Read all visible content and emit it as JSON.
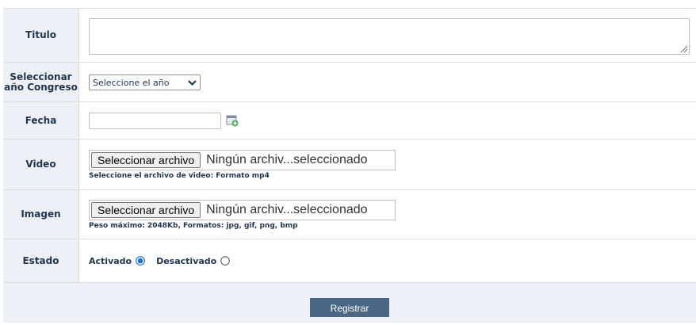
{
  "form": {
    "titulo": {
      "label": "Titulo",
      "value": ""
    },
    "congreso": {
      "label": "Seleccionar año Congreso",
      "selected": "Seleccione el año"
    },
    "fecha": {
      "label": "Fecha",
      "value": ""
    },
    "video": {
      "label": "Video",
      "button": "Seleccionar archivo",
      "status": "Ningún archiv...seleccionado",
      "hint": "Seleccione el archivo de video: Formato mp4"
    },
    "imagen": {
      "label": "Imagen",
      "button": "Seleccionar archivo",
      "status": "Ningún archiv...seleccionado",
      "hint": "Peso máximo: 2048Kb, Formatos: jpg, gif, png, bmp"
    },
    "estado": {
      "label": "Estado",
      "options": [
        {
          "label": "Activado",
          "checked": true
        },
        {
          "label": "Desactivado",
          "checked": false
        }
      ]
    },
    "submit": "Registrar"
  },
  "icons": {
    "calendar": "calendar-add-icon",
    "dropdown": "chevron-down-icon"
  },
  "colors": {
    "label_bg": "#edf1f7",
    "label_text": "#1f3550",
    "radio_selected": "#1a73e8",
    "submit_bg": "#4a6785"
  }
}
